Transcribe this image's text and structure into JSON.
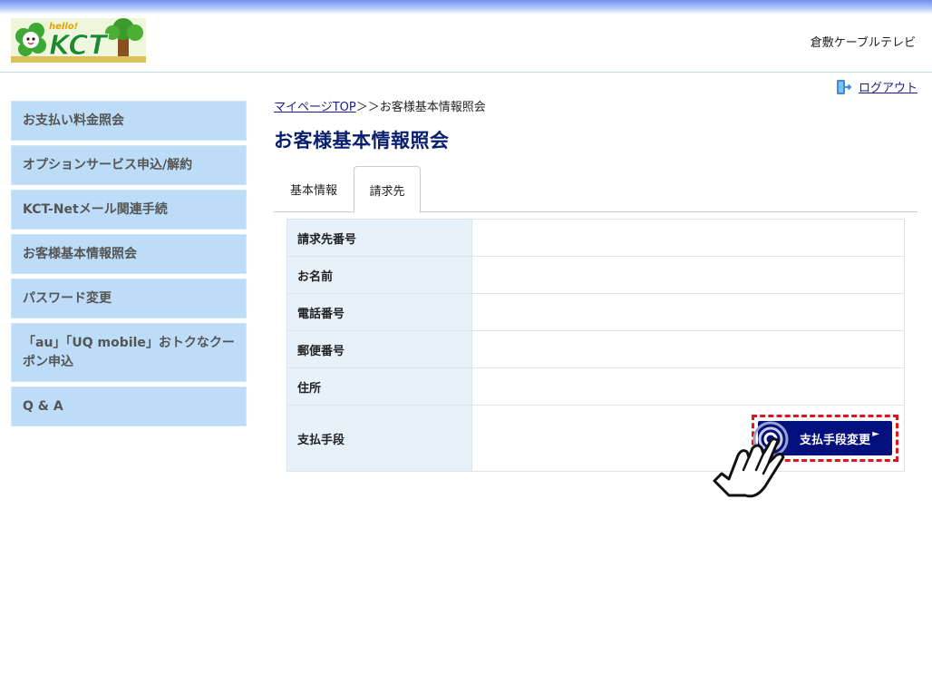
{
  "header": {
    "logo": {
      "top_text": "hello!",
      "main_text": "KCT"
    },
    "company_name": "倉敷ケーブルテレビ",
    "logout_label": "ログアウト"
  },
  "sidebar": {
    "items": [
      {
        "label": "お支払い料金照会"
      },
      {
        "label": "オプションサービス申込/解約"
      },
      {
        "label": "KCT-Netメール関連手続"
      },
      {
        "label": "お客様基本情報照会"
      },
      {
        "label": "パスワード変更"
      },
      {
        "label": "「au」「UQ mobile」おトクなクーポン申込"
      },
      {
        "label": "Q & A"
      }
    ]
  },
  "breadcrumb": {
    "link": "マイページTOP",
    "separator": "＞＞",
    "current": "お客様基本情報照会"
  },
  "page_title": "お客様基本情報照会",
  "tabs": [
    {
      "label": "基本情報",
      "active": false
    },
    {
      "label": "請求先",
      "active": true
    }
  ],
  "billing_table": {
    "rows": [
      {
        "label": "請求先番号",
        "value": ""
      },
      {
        "label": "お名前",
        "value": ""
      },
      {
        "label": "電話番号",
        "value": ""
      },
      {
        "label": "郵便番号",
        "value": ""
      },
      {
        "label": "住所",
        "value": ""
      },
      {
        "label": "支払手段",
        "value": ""
      }
    ],
    "change_payment_button": "支払手段変更"
  },
  "colors": {
    "sidebar_bg": "#bcdcf7",
    "title_color": "#0a1f6e",
    "button_bg": "#04107e",
    "highlight_border": "#e0151c"
  }
}
